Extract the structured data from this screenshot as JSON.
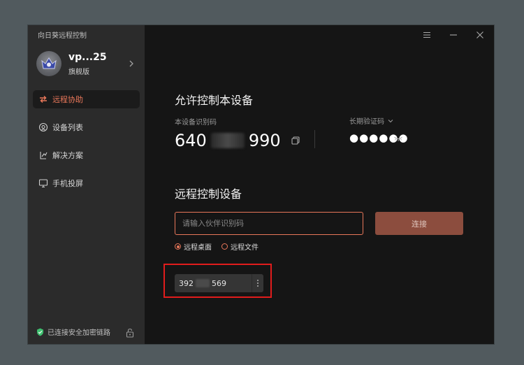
{
  "app": {
    "title": "向日葵远程控制"
  },
  "profile": {
    "username": "vp...25",
    "edition": "旗舰版"
  },
  "nav": [
    {
      "label": "远程协助",
      "icon": "remote-assist-icon",
      "active": true
    },
    {
      "label": "设备列表",
      "icon": "device-list-icon",
      "active": false
    },
    {
      "label": "解决方案",
      "icon": "solution-icon",
      "active": false
    },
    {
      "label": "手机投屏",
      "icon": "screen-cast-icon",
      "active": false
    }
  ],
  "footer": {
    "status": "已连接安全加密链路"
  },
  "allow": {
    "title": "允许控制本设备",
    "id_label": "本设备识别码",
    "id_prefix": "640",
    "id_suffix": "990",
    "verify_label": "长期验证码",
    "password_mask": "●●●●●●"
  },
  "control": {
    "title": "远程控制设备",
    "input_placeholder": "请输入伙伴识别码",
    "connect_label": "连接",
    "modes": [
      {
        "label": "远程桌面",
        "selected": true
      },
      {
        "label": "远程文件",
        "selected": false
      }
    ]
  },
  "recent": {
    "id_prefix": "392",
    "id_suffix": "569"
  },
  "colors": {
    "accent": "#e8775a",
    "connect_button": "#8c4d3e",
    "highlight": "#e01c1c"
  }
}
